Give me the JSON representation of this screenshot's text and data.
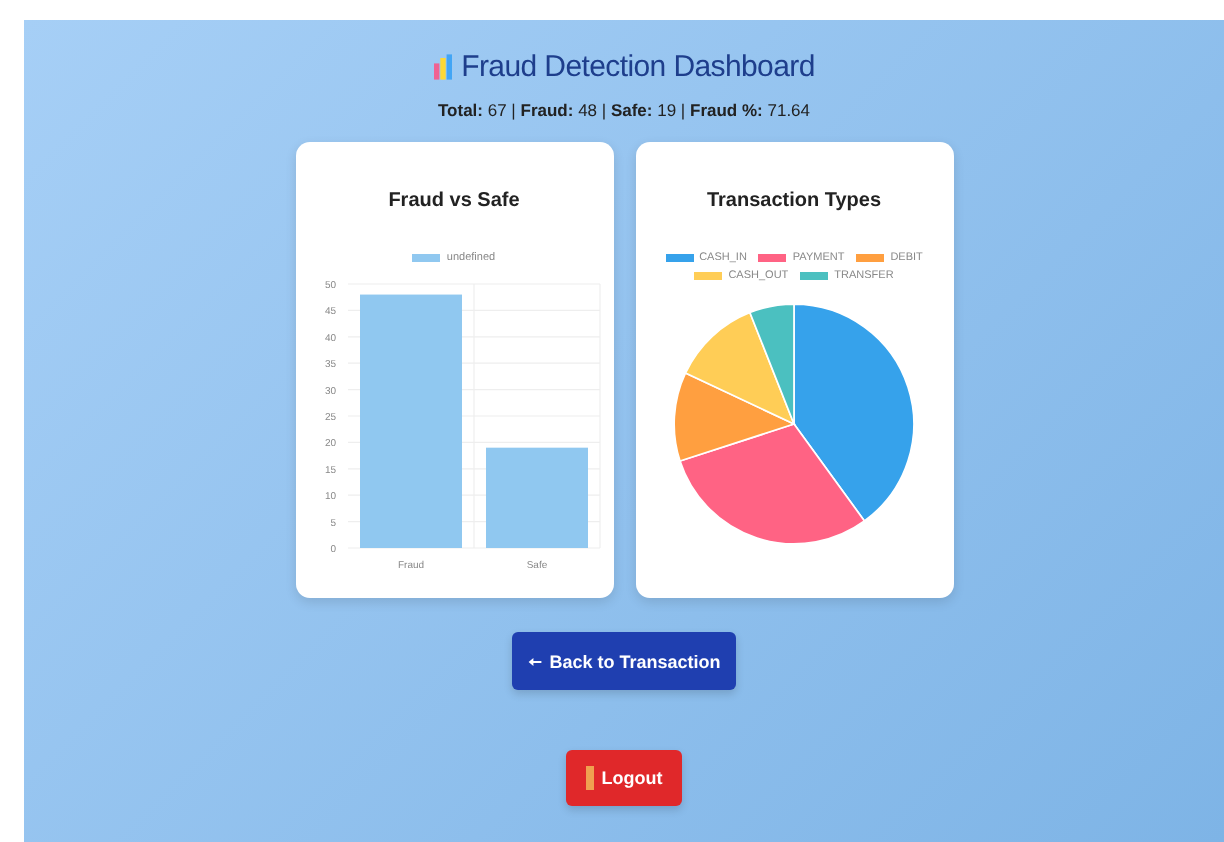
{
  "header": {
    "title": "Fraud Detection Dashboard",
    "stats": "**Total:** 67 | **Fraud:** 48 | **Safe:** 19 | **Fraud %:** 71.64"
  },
  "charts": [
    {
      "title": "Fraud vs Safe",
      "chart_data": {
        "type": "bar",
        "categories": [
          "Fraud",
          "Safe"
        ],
        "series": [
          {
            "name": "undefined",
            "color": "#90c8f0",
            "values": [
              48,
              19
            ]
          }
        ],
        "ylim": [
          0,
          50
        ],
        "grid": true,
        "yticks": [
          0,
          5,
          10,
          15,
          20,
          25,
          30,
          35,
          40,
          45,
          50
        ]
      }
    },
    {
      "title": "Transaction Types",
      "chart_data": {
        "type": "pie",
        "categories": [
          "CASH_IN",
          "PAYMENT",
          "DEBIT",
          "CASH_OUT",
          "TRANSFER"
        ],
        "values": [
          40,
          30,
          12,
          12,
          6
        ],
        "colors": [
          "#36a2eb",
          "#ff6384",
          "#ff9f40",
          "#ffcd56",
          "#4bc0c0"
        ]
      }
    }
  ],
  "buttons": [
    {
      "kind": "back",
      "label": "Back to Transaction"
    },
    {
      "kind": "logout",
      "label": "Logout"
    }
  ]
}
